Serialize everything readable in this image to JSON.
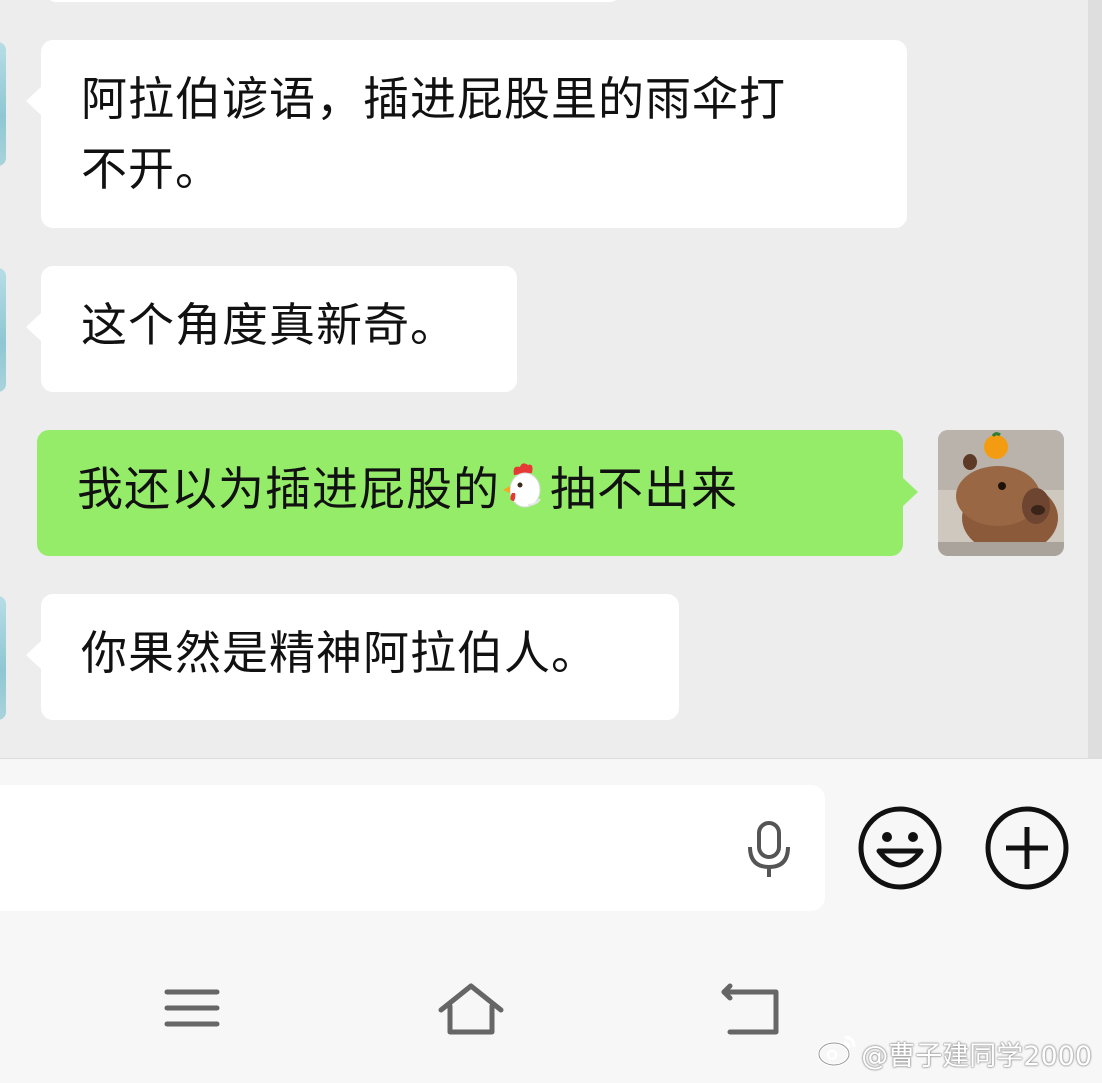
{
  "messages": [
    {
      "side": "left",
      "text_line1": "阿拉伯谚语，插进屁股里的雨伞打",
      "text_line2": "不开。"
    },
    {
      "side": "left",
      "text": "这个角度真新奇。"
    },
    {
      "side": "right",
      "text_before": "我还以为插进屁股的",
      "emoji": "🐔",
      "emoji_name": "chicken-emoji",
      "text_after": "抽不出来"
    },
    {
      "side": "left",
      "text": "你果然是精神阿拉伯人。"
    }
  ],
  "input": {
    "value": "",
    "placeholder": ""
  },
  "icons": {
    "mic": "microphone-icon",
    "emoji": "smiley-icon",
    "more": "plus-icon",
    "menu": "menu-icon",
    "home": "home-icon",
    "back": "back-icon"
  },
  "colors": {
    "chat_background": "#ededed",
    "bubble_incoming": "#ffffff",
    "bubble_outgoing": "#95ec69"
  },
  "watermark": {
    "text": "@曹子建同学2000"
  }
}
